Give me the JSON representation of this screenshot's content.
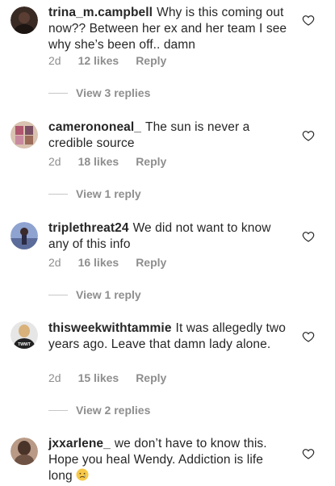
{
  "comments": [
    {
      "username": "trina_m.campbell",
      "text": "Why is this coming out now?? Between her ex and her team I see why she’s been off.. damn",
      "time": "2d",
      "likes": "12 likes",
      "reply": "Reply",
      "view_replies": "View 3 replies",
      "avatar_color": "#3a2a24"
    },
    {
      "username": "camerononeal_",
      "text": "The sun is never a credible source",
      "time": "2d",
      "likes": "18 likes",
      "reply": "Reply",
      "view_replies": "View 1 reply",
      "avatar_color": "#c9a68f"
    },
    {
      "username": "triplethreat24",
      "text": "We did not want to know any of this info",
      "time": "2d",
      "likes": "16 likes",
      "reply": "Reply",
      "view_replies": "View 1 reply",
      "avatar_color": "#6a7fb0"
    },
    {
      "username": "thisweekwithtammie",
      "text": "It was allegedly two years ago. Leave that damn lady alone.",
      "time": "2d",
      "likes": "15 likes",
      "reply": "Reply",
      "view_replies": "View 2 replies",
      "avatar_color": "#2b2b2b",
      "avatar_text": "TWWT"
    },
    {
      "username": "jxxarlene_",
      "text": "we don’t have to know this. Hope you heal Wendy. Addiction is life long",
      "emoji": "crying-face",
      "avatar_color": "#5a4a40"
    }
  ],
  "colors": {
    "text": "#262626",
    "secondary": "#8e8e8e",
    "divider": "#c7c7c7"
  }
}
